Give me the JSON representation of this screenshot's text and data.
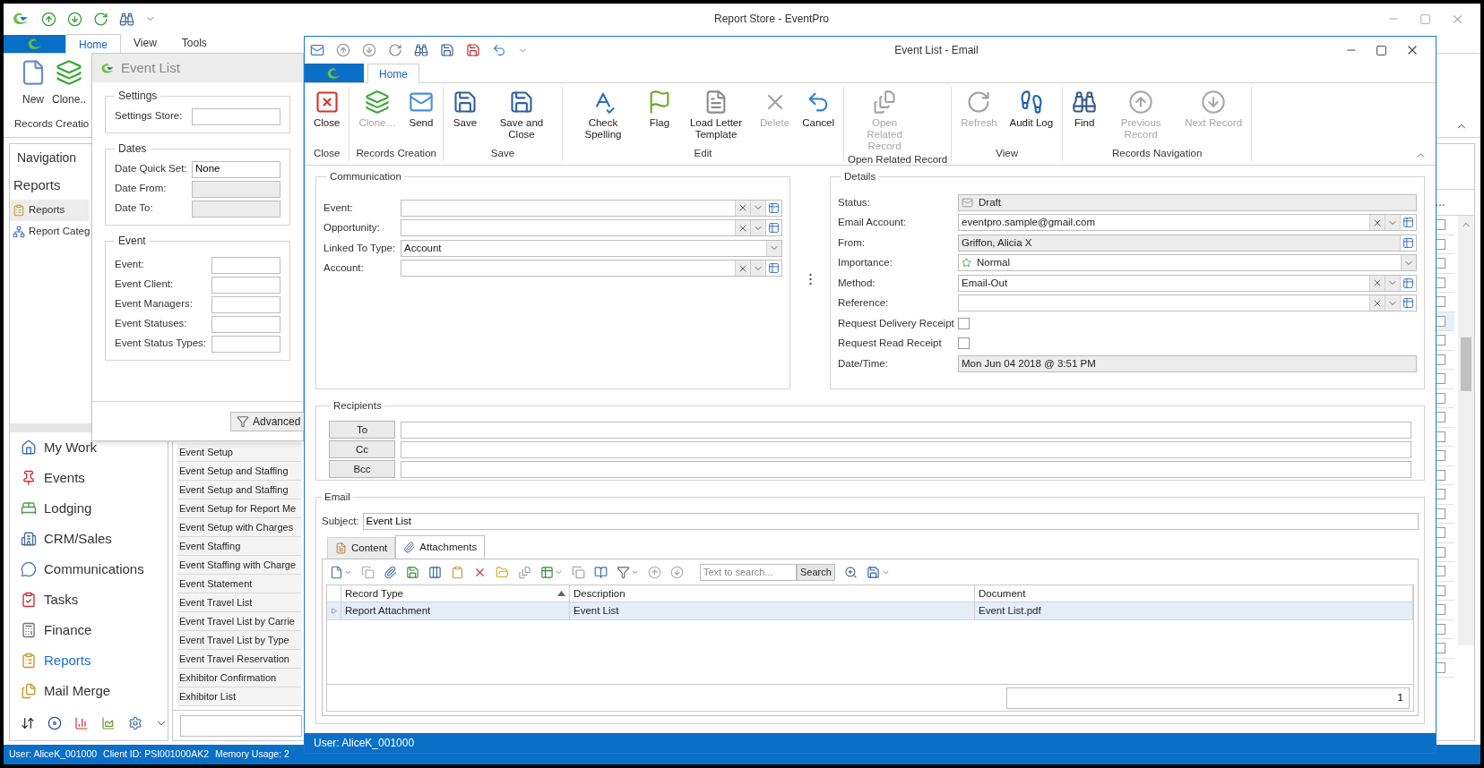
{
  "main_window": {
    "title": "Report Store - EventPro",
    "ribbon_tabs": [
      {
        "label": "Home",
        "selected": true
      },
      {
        "label": "View",
        "selected": false
      },
      {
        "label": "Tools",
        "selected": false
      }
    ],
    "ribbon_buttons": [
      "New",
      "Clone.."
    ],
    "ribbon_group": "Records Creatio",
    "navigation": {
      "title": "Navigation",
      "section": "Reports",
      "items": [
        {
          "label": "Reports",
          "selected": true
        },
        {
          "label": "Report Categ",
          "selected": false
        }
      ]
    },
    "modules": [
      {
        "label": "My Work",
        "selected": false
      },
      {
        "label": "Events",
        "selected": false
      },
      {
        "label": "Lodging",
        "selected": false
      },
      {
        "label": "CRM/Sales",
        "selected": false
      },
      {
        "label": "Communications",
        "selected": false
      },
      {
        "label": "Tasks",
        "selected": false
      },
      {
        "label": "Finance",
        "selected": false
      },
      {
        "label": "Reports",
        "selected": true
      },
      {
        "label": "Mail Merge",
        "selected": false
      }
    ],
    "report_rows": [
      "Event Setup",
      "Event Setup and Staffing",
      "Event Setup and Staffing",
      "Event Setup for Report Me",
      "Event Setup with Charges",
      "Event Staffing",
      "Event Staffing with Charge",
      "Event Statement",
      "Event Travel List",
      "Event Travel List by Carrie",
      "Event Travel List by Type",
      "Event Travel Reservation",
      "Exhibitor Confirmation",
      "Exhibitor List"
    ],
    "column_header": "…",
    "grid_rows": [
      {
        "checked": false,
        "selected": false
      },
      {
        "checked": false,
        "selected": false
      },
      {
        "checked": false,
        "selected": false
      },
      {
        "checked": false,
        "selected": false
      },
      {
        "checked": false,
        "selected": false
      },
      {
        "checked": false,
        "selected": true
      },
      {
        "checked": false,
        "selected": false
      },
      {
        "checked": false,
        "selected": false
      },
      {
        "checked": false,
        "selected": false
      },
      {
        "checked": false,
        "selected": false
      },
      {
        "checked": false,
        "selected": false
      },
      {
        "checked": false,
        "selected": false
      },
      {
        "checked": false,
        "selected": false
      },
      {
        "checked": false,
        "selected": false
      },
      {
        "checked": false,
        "selected": false
      },
      {
        "checked": false,
        "selected": false
      },
      {
        "checked": false,
        "selected": false
      },
      {
        "checked": false,
        "selected": false
      },
      {
        "checked": false,
        "selected": false
      },
      {
        "checked": false,
        "selected": false
      },
      {
        "checked": false,
        "selected": false
      },
      {
        "checked": false,
        "selected": false
      },
      {
        "checked": false,
        "selected": false
      },
      {
        "checked": false,
        "selected": false
      }
    ],
    "status": [
      "User: AliceK_001000",
      "Client ID: PSI001000AK2",
      "Memory Usage: 2"
    ]
  },
  "event_list_dialog": {
    "title": "Event List",
    "sections": [
      {
        "title": "Settings",
        "fields": [
          {
            "label": "Settings Store:",
            "disabled": false
          }
        ]
      },
      {
        "title": "Dates",
        "fields": [
          {
            "label": "Date Quick Set:",
            "value": "None",
            "disabled": false
          },
          {
            "label": "Date From:",
            "disabled": true
          },
          {
            "label": "Date To:",
            "disabled": true
          }
        ]
      },
      {
        "title": "Event",
        "fields": [
          {
            "label": "Event:",
            "disabled": false
          },
          {
            "label": "Event Client:",
            "disabled": false
          },
          {
            "label": "Event Managers:",
            "disabled": false
          },
          {
            "label": "Event Statuses:",
            "disabled": false
          },
          {
            "label": "Event Status Types:",
            "disabled": false
          }
        ]
      }
    ],
    "button": "Advanced"
  },
  "email_window": {
    "title": "Event List - Email",
    "tabs": [
      {
        "label": "Home",
        "selected": true
      }
    ],
    "ribbon_groups": [
      {
        "label": "Close",
        "buttons": [
          {
            "label": "Close",
            "disabled": false
          }
        ]
      },
      {
        "label": "Records Creation",
        "buttons": [
          {
            "label": "Clone…",
            "disabled": true
          },
          {
            "label": "Send",
            "disabled": false
          }
        ]
      },
      {
        "label": "Save",
        "buttons": [
          {
            "label": "Save",
            "disabled": false
          },
          {
            "label": "Save and Close",
            "disabled": false
          }
        ]
      },
      {
        "label": "Edit",
        "buttons": [
          {
            "label": "Check Spelling",
            "disabled": false
          },
          {
            "label": "Flag",
            "disabled": false
          },
          {
            "label": "Load Letter Template",
            "disabled": false
          },
          {
            "label": "Delete",
            "disabled": true
          },
          {
            "label": "Cancel",
            "disabled": false
          }
        ]
      },
      {
        "label": "Open Related Record",
        "buttons": [
          {
            "label": "Open Related Record",
            "disabled": true
          }
        ]
      },
      {
        "label": "View",
        "buttons": [
          {
            "label": "Refresh",
            "disabled": true
          },
          {
            "label": "Audit Log",
            "disabled": false
          }
        ]
      },
      {
        "label": "Records Navigation",
        "buttons": [
          {
            "label": "Find",
            "disabled": false
          },
          {
            "label": "Previous Record",
            "disabled": true
          },
          {
            "label": "Next Record",
            "disabled": true
          }
        ]
      }
    ],
    "communication": {
      "title": "Communication",
      "fields": [
        {
          "label": "Event:",
          "kind": "lookup"
        },
        {
          "label": "Opportunity:",
          "kind": "lookup"
        },
        {
          "label": "Linked To Type:",
          "kind": "combo",
          "value": "Account"
        },
        {
          "label": "Account:",
          "kind": "lookup"
        }
      ]
    },
    "details": {
      "title": "Details",
      "fields": [
        {
          "label": "Status:",
          "kind": "status",
          "value": "Draft"
        },
        {
          "label": "Email Account:",
          "kind": "lookup",
          "value": "eventpro.sample@gmail.com"
        },
        {
          "label": "From:",
          "kind": "readonly_lookup",
          "value": "Griffon, Alicia X"
        },
        {
          "label": "Importance:",
          "kind": "priority",
          "value": "Normal"
        },
        {
          "label": "Method:",
          "kind": "lookup",
          "value": "Email-Out"
        },
        {
          "label": "Reference:",
          "kind": "lookup"
        },
        {
          "label": "Request Delivery Receipt",
          "kind": "checkbox",
          "checked": false
        },
        {
          "label": "Request Read Receipt",
          "kind": "checkbox",
          "checked": false
        },
        {
          "label": "Date/Time:",
          "kind": "readonly",
          "value": "Mon Jun 04 2018 @ 3:51 PM"
        }
      ]
    },
    "recipients": {
      "title": "Recipients",
      "buttons": [
        "To",
        "Cc",
        "Bcc"
      ]
    },
    "email": {
      "title": "Email",
      "subject_label": "Subject:",
      "subject": "Event List",
      "tabs": [
        {
          "label": "Content",
          "selected": false
        },
        {
          "label": "Attachments",
          "selected": true
        }
      ],
      "search_placeholder": "Text to search...",
      "search_button": "Search",
      "columns": [
        "Record Type",
        "Description",
        "Document"
      ],
      "rows": [
        {
          "cells": [
            "Report Attachment",
            "Event List",
            "Event List.pdf"
          ],
          "selected": true
        }
      ],
      "footer_count": "1"
    },
    "status": "User: AliceK_001000"
  }
}
